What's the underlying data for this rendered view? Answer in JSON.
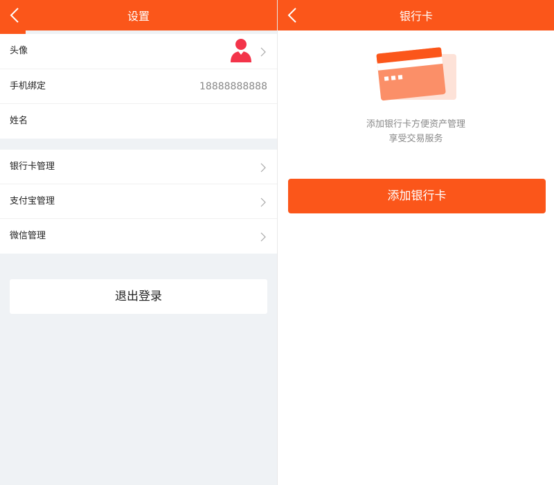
{
  "left": {
    "title": "设置",
    "profile_rows": [
      {
        "label": "头像",
        "value": ""
      },
      {
        "label": "手机绑定",
        "value": "18888888888"
      },
      {
        "label": "姓名",
        "value": ""
      }
    ],
    "account_rows": [
      {
        "label": "银行卡管理"
      },
      {
        "label": "支付宝管理"
      },
      {
        "label": "微信管理"
      }
    ],
    "logout_label": "退出登录"
  },
  "right": {
    "title": "银行卡",
    "empty_line1": "添加银行卡方便资产管理",
    "empty_line2": "享受交易服务",
    "add_button_label": "添加银行卡"
  },
  "colors": {
    "accent": "#fb561a",
    "avatar": "#f3344a",
    "background": "#eff2f5"
  }
}
